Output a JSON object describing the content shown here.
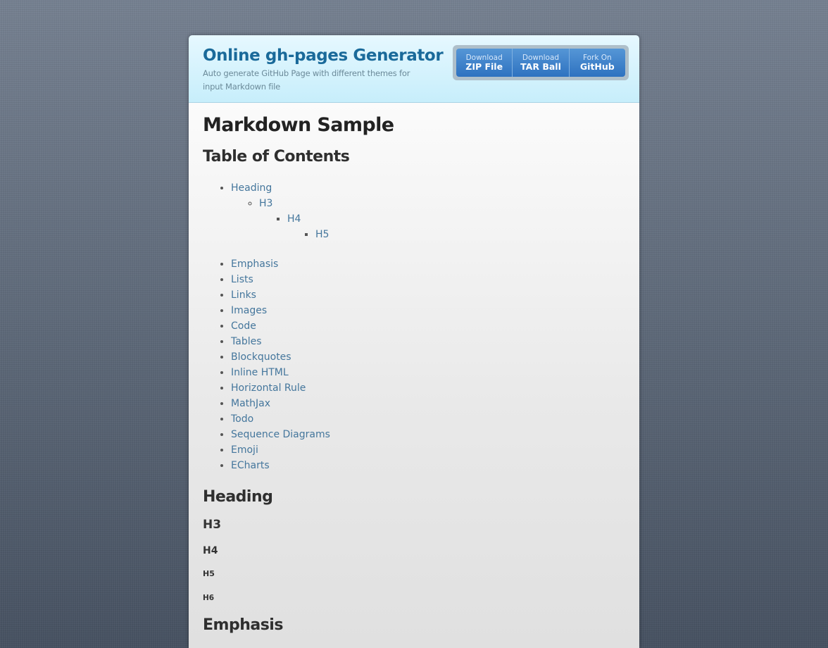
{
  "header": {
    "title": "Online gh-pages Generator",
    "tagline": "Auto generate GitHub Page with different themes for input Markdown file"
  },
  "downloads": [
    {
      "small": "Download",
      "big": "ZIP File"
    },
    {
      "small": "Download",
      "big": "TAR Ball"
    },
    {
      "small": "Fork On",
      "big": "GitHub"
    }
  ],
  "content": {
    "title": "Markdown Sample",
    "toc_heading": "Table of Contents",
    "toc_nested": [
      "Heading",
      "H3",
      "H4",
      "H5"
    ],
    "toc_items": [
      "Emphasis",
      "Lists",
      "Links",
      "Images",
      "Code",
      "Tables",
      "Blockquotes",
      "Inline HTML",
      "Horizontal Rule",
      "MathJax",
      "Todo",
      "Sequence Diagrams",
      "Emoji",
      "ECharts"
    ],
    "heading_section": "Heading",
    "h3": "H3",
    "h4": "H4",
    "h5": "H5",
    "h6": "H6",
    "emphasis_section": "Emphasis"
  },
  "colors": {
    "title": "#1a6a9a",
    "link": "#44769c",
    "button": "#2e72c0"
  }
}
